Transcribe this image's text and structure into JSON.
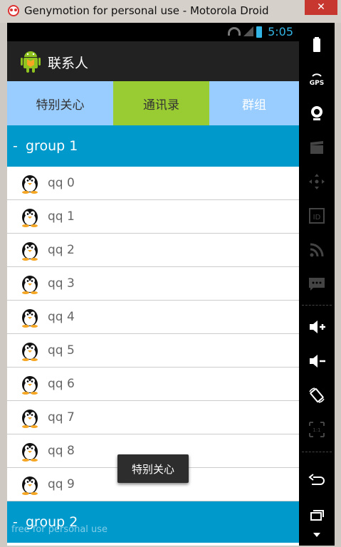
{
  "window": {
    "title": "Genymotion for personal use - Motorola Droid",
    "close_label": "✕"
  },
  "statusbar": {
    "time": "5:05"
  },
  "actionbar": {
    "title": "联系人"
  },
  "tabs": [
    {
      "label": "特别关心"
    },
    {
      "label": "通讯录"
    },
    {
      "label": "群组"
    }
  ],
  "groups": [
    {
      "sign": "-",
      "title": "group 1",
      "items": [
        "qq 0",
        "qq 1",
        "qq 2",
        "qq 3",
        "qq 4",
        "qq 5",
        "qq 6",
        "qq 7",
        "qq 8",
        "qq 9"
      ]
    },
    {
      "sign": "-",
      "title": "group 2",
      "items": []
    }
  ],
  "toast": {
    "text": "特别关心"
  },
  "watermark": "free for personal use",
  "colors": {
    "tab_default": "#99ccff",
    "tab_selected": "#99cc33",
    "group_header": "#0099cc",
    "time": "#33b5e5"
  },
  "sidebar_icons": [
    "battery-icon",
    "gps-icon",
    "camera-icon",
    "video-icon",
    "dpad-icon",
    "id-icon",
    "rss-icon",
    "sms-icon",
    "volume-up-icon",
    "volume-down-icon",
    "rotate-icon",
    "pixel-perfect-icon",
    "back-icon",
    "recent-apps-icon",
    "menu-icon"
  ],
  "sidebar_labels": {
    "gps": "GPS",
    "id": "ID",
    "pixel": "1:1"
  }
}
